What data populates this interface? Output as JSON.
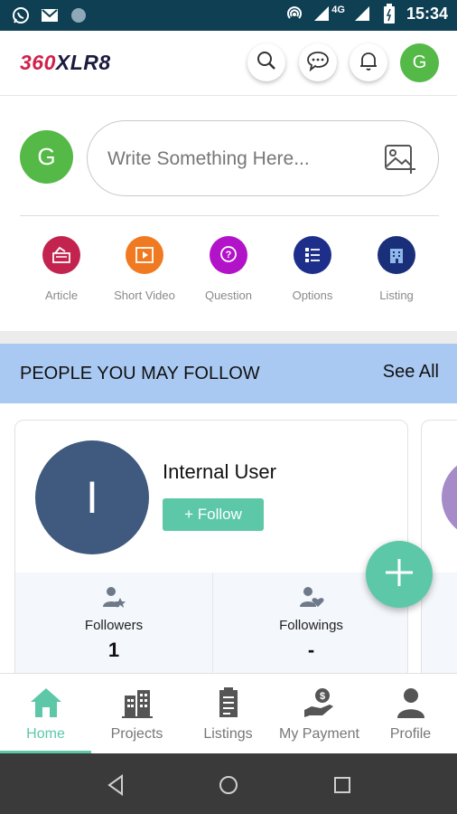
{
  "status_bar": {
    "time": "15:34",
    "network": "4G",
    "left_icons": [
      "whatsapp-icon",
      "gmail-icon",
      "circle-icon"
    ],
    "right_icons": [
      "hotspot-icon",
      "signal-icon",
      "battery-icon"
    ]
  },
  "header": {
    "logo_part1": "360",
    "logo_part2": "XLR8",
    "avatar_letter": "G",
    "icons": [
      "search-icon",
      "chat-icon",
      "bell-icon"
    ]
  },
  "composer": {
    "avatar_letter": "G",
    "placeholder": "Write Something Here...",
    "actions": [
      {
        "label": "Article",
        "icon": "article-icon",
        "color": "#c2234f"
      },
      {
        "label": "Short Video",
        "icon": "video-icon",
        "color": "#f07a22"
      },
      {
        "label": "Question",
        "icon": "question-icon",
        "color": "#b213c9"
      },
      {
        "label": "Options",
        "icon": "options-icon",
        "color": "#1d2f8a"
      },
      {
        "label": "Listing",
        "icon": "building-icon",
        "color": "#1a2f7a"
      }
    ]
  },
  "people_you_may_follow": {
    "title": "PEOPLE YOU MAY FOLLOW",
    "see_all": "See All",
    "cards": [
      {
        "avatar_letter": "I",
        "name": "Internal User",
        "follow_label": "+ Follow",
        "followers_label": "Followers",
        "followers_value": "1",
        "followings_label": "Followings",
        "followings_value": "-"
      }
    ]
  },
  "bottom_nav": {
    "items": [
      {
        "label": "Home",
        "icon": "home-icon",
        "active": true
      },
      {
        "label": "Projects",
        "icon": "buildings-icon",
        "active": false
      },
      {
        "label": "Listings",
        "icon": "listings-icon",
        "active": false
      },
      {
        "label": "My Payment",
        "icon": "payment-icon",
        "active": false
      },
      {
        "label": "Profile",
        "icon": "profile-icon",
        "active": false
      }
    ]
  },
  "colors": {
    "status_bar": "#0e3f53",
    "accent": "#5cc8a8",
    "avatar_green": "#55b947",
    "banner_blue": "#a9c9f2",
    "card_avatar": "#3f5a7e",
    "system_nav": "#3a3a3a"
  }
}
